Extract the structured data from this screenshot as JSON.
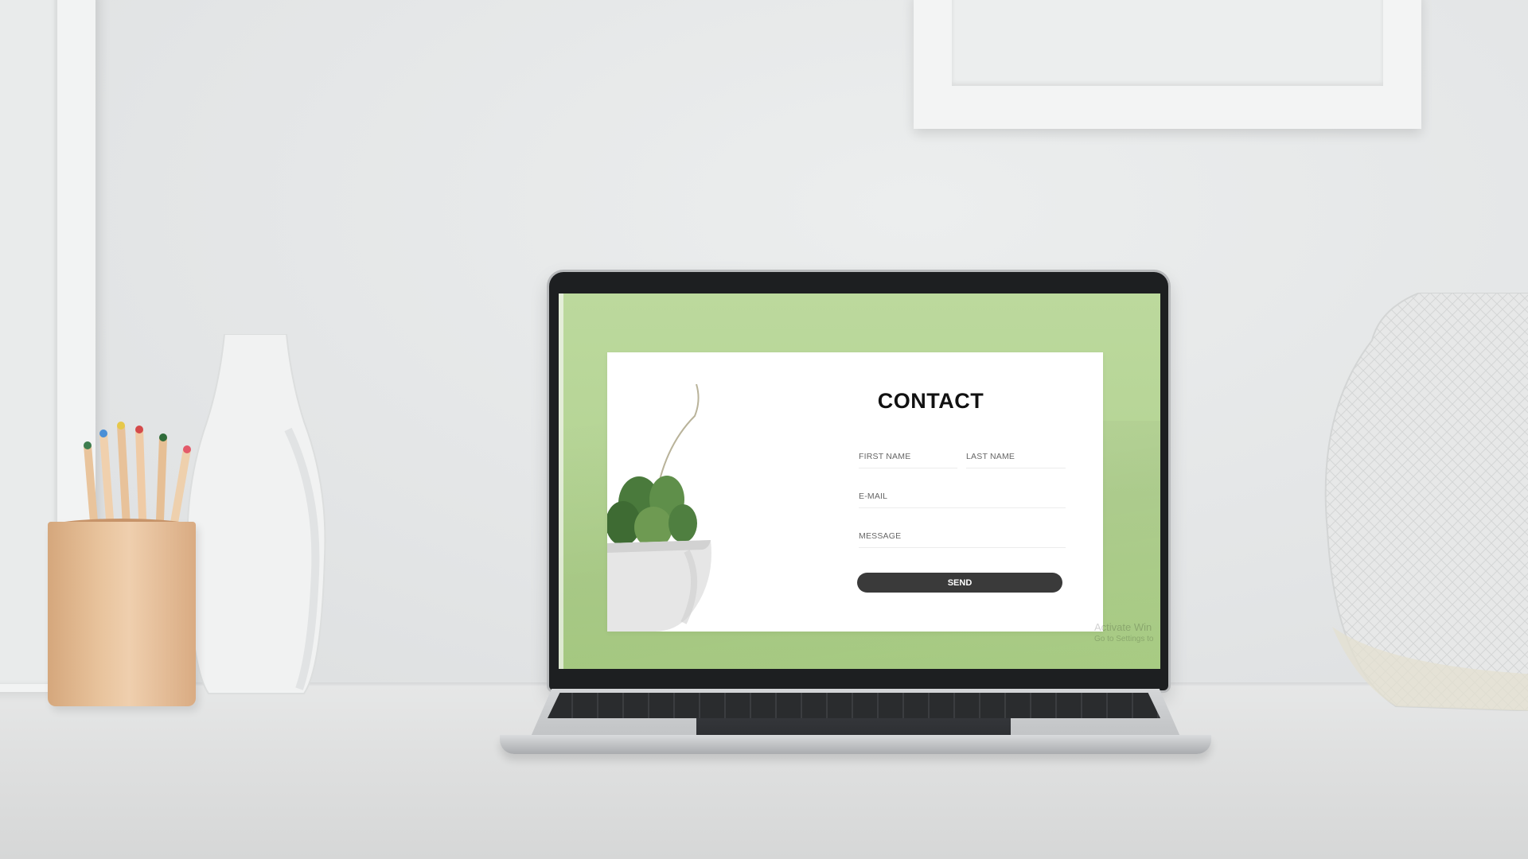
{
  "contact_form": {
    "title": "CONTACT",
    "first_name_placeholder": "FIRST NAME",
    "last_name_placeholder": "LAST NAME",
    "email_placeholder": "E-MAIL",
    "message_placeholder": "MESSAGE",
    "send_label": "SEND"
  },
  "watermark": {
    "line1": "Activate Win",
    "line2": "Go to Settings to"
  },
  "colors": {
    "screen_background": "#b6d596",
    "card_background": "#ffffff",
    "send_button": "#3a3a3a"
  }
}
